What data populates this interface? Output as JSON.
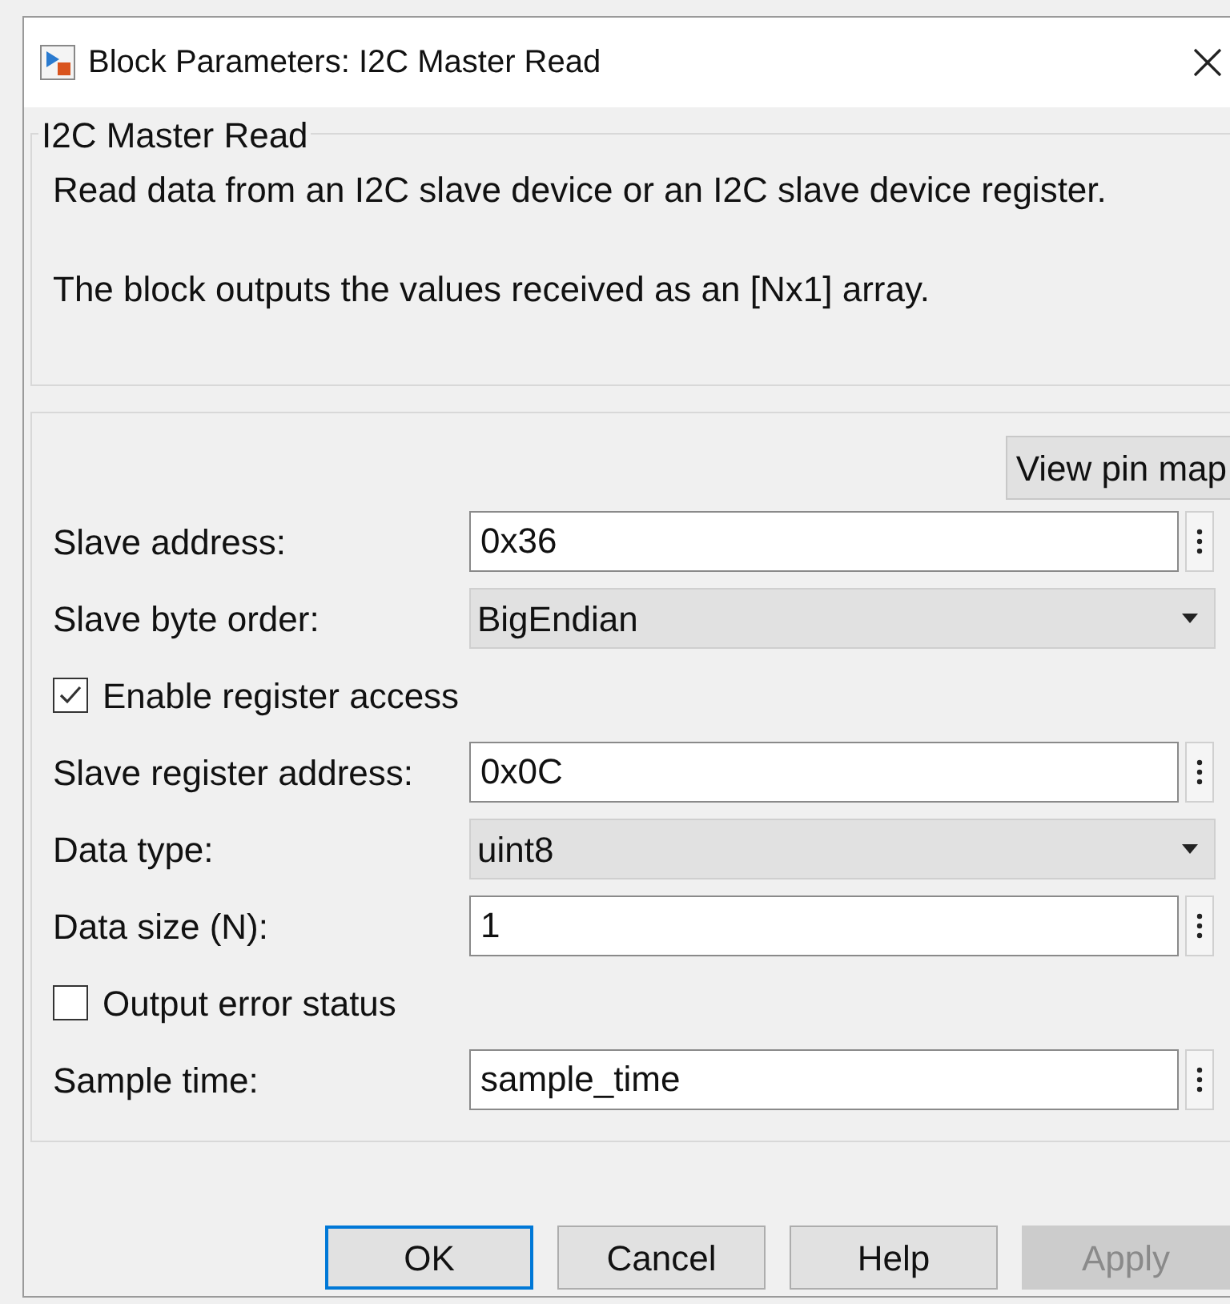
{
  "window": {
    "title": "Block Parameters: I2C Master Read"
  },
  "description": {
    "title": "I2C Master Read",
    "paragraphs": [
      "Read data from an I2C slave device or an I2C slave device register.",
      "The block outputs the values received as an [Nx1] array."
    ]
  },
  "pin_map_button": "View pin map",
  "parameters": [
    {
      "kind": "field",
      "label": "Slave address:",
      "value": "0x36"
    },
    {
      "kind": "dropdown",
      "label": "Slave byte order:",
      "value": "BigEndian"
    },
    {
      "kind": "checkbox",
      "label": "Enable register access",
      "checked": true
    },
    {
      "kind": "field",
      "label": "Slave register address:",
      "value": "0x0C"
    },
    {
      "kind": "dropdown",
      "label": "Data type:",
      "value": "uint8"
    },
    {
      "kind": "field",
      "label": "Data size (N):",
      "value": "1"
    },
    {
      "kind": "checkbox",
      "label": "Output error status",
      "checked": false
    },
    {
      "kind": "field",
      "label": "Sample time:",
      "value": "sample_time"
    }
  ],
  "buttons": [
    {
      "label": "OK",
      "default": true,
      "disabled": false
    },
    {
      "label": "Cancel",
      "default": false,
      "disabled": false
    },
    {
      "label": "Help",
      "default": false,
      "disabled": false
    },
    {
      "label": "Apply",
      "default": false,
      "disabled": true
    }
  ]
}
